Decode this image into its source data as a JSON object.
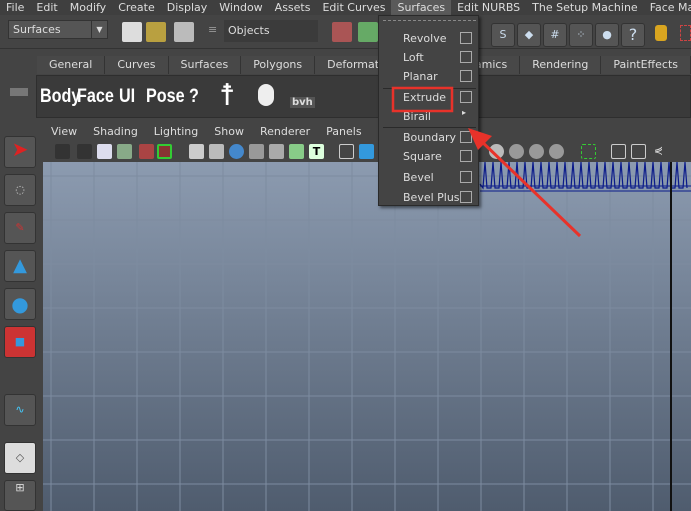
{
  "menubar": [
    "File",
    "Edit",
    "Modify",
    "Create",
    "Display",
    "Window",
    "Assets",
    "Edit Curves",
    "Surfaces",
    "Edit NURBS",
    "The Setup Machine",
    "Face Machine"
  ],
  "toolbar": {
    "mode": "Surfaces",
    "object_field": "Objects"
  },
  "shelf": {
    "tabs": [
      "General",
      "Curves",
      "Surfaces",
      "Polygons",
      "Deformation",
      "",
      "Dynamics",
      "Rendering",
      "PaintEffects"
    ],
    "buttons": [
      "Body",
      "Face",
      "UI",
      "Pose",
      "?"
    ],
    "bvh": "bvh"
  },
  "panel_menu": [
    "View",
    "Shading",
    "Lighting",
    "Show",
    "Renderer",
    "Panels"
  ],
  "surfaces_menu": {
    "items": [
      {
        "label": "Revolve",
        "option": true
      },
      {
        "label": "Loft",
        "option": true
      },
      {
        "label": "Planar",
        "option": true
      },
      {
        "label": "Extrude",
        "option": true,
        "highlighted": true
      },
      {
        "label": "Birail",
        "submenu": true
      },
      {
        "label": "Boundary",
        "option": true
      },
      {
        "label": "Square",
        "option": true
      },
      {
        "label": "Bevel",
        "option": true
      },
      {
        "label": "Bevel Plus",
        "option": true
      }
    ]
  },
  "colors": {
    "annotation": "#e8322a",
    "curve": "#0a1a8a"
  }
}
